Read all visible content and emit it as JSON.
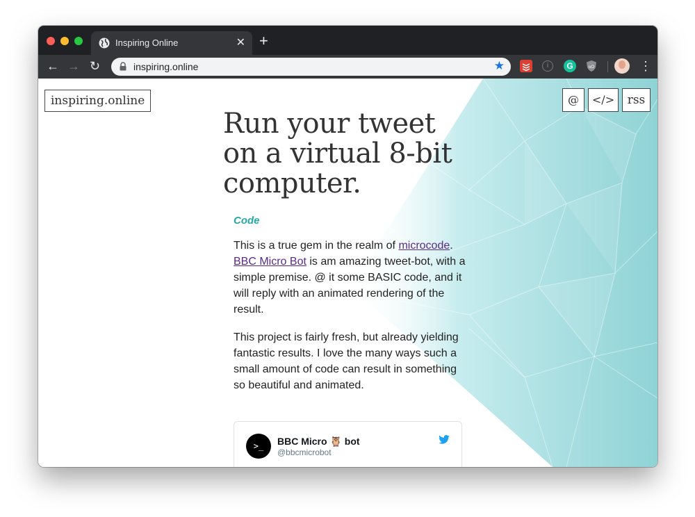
{
  "browser": {
    "tab_title": "Inspiring Online",
    "tab_close": "✕",
    "new_tab": "+",
    "url": "inspiring.online",
    "back": "←",
    "forward": "→",
    "reload": "↻",
    "star": "★",
    "menu": "⋮",
    "info_ext": "i",
    "grammarly_ext": "G"
  },
  "site": {
    "logo": "inspiring.online",
    "nav": {
      "contact": "@",
      "code": "</>",
      "rss": "rss"
    }
  },
  "article": {
    "title": "Run your tweet on a virtual 8-bit computer.",
    "category": "Code",
    "p1": {
      "before": "This is a true gem in the realm of ",
      "link1": "microcode",
      "between": ". ",
      "link2": "BBC Micro Bot",
      "after": " is am amazing tweet-bot, with a simple premise. @ it some BASIC code, and it will reply with an animated rendering of the result."
    },
    "p2": "This project is fairly fresh, but already yielding fantastic results. I love the many ways such a small amount of code can result in something so beautiful and animated."
  },
  "tweet": {
    "avatar_text": ">_",
    "name": "BBC Micro 🦉 bot",
    "handle": "@bbcmicrobot"
  },
  "colors": {
    "accent": "#26a8a8",
    "link": "#5b2a86",
    "twitter": "#1da1f2",
    "bg_art": "#8fd3d6"
  }
}
